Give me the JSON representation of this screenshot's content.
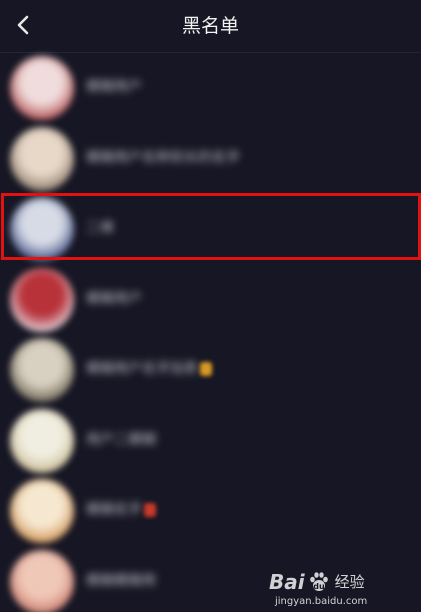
{
  "header": {
    "title": "黑名单",
    "back_icon": "chevron-left-icon"
  },
  "blacklist": [
    {
      "name": "模糊用户",
      "avatar_colors": [
        "#f0dcdc",
        "#b04a4a"
      ],
      "badge": null
    },
    {
      "name": "模糊用户名称较长的名字",
      "avatar_colors": [
        "#e8d8c8",
        "#8a7a6a"
      ],
      "badge": null
    },
    {
      "name": "二维",
      "avatar_colors": [
        "#d7dbe6",
        "#3a4a80"
      ],
      "badge": null
    },
    {
      "name": "模糊用户",
      "avatar_colors": [
        "#b8323a",
        "#e8e8ee"
      ],
      "badge": null
    },
    {
      "name": "模糊用户名字加表",
      "avatar_colors": [
        "#d8d0c0",
        "#6a6250"
      ],
      "badge": "#d99a25"
    },
    {
      "name": "用户二模糊",
      "avatar_colors": [
        "#f0eee0",
        "#c8b890"
      ],
      "badge": null
    },
    {
      "name": "模糊名字",
      "avatar_colors": [
        "#f6e8d0",
        "#d09050"
      ],
      "badge": "#c83a2a"
    },
    {
      "name": "模糊模糊用",
      "avatar_colors": [
        "#f0c8b8",
        "#c8786a"
      ],
      "badge": null
    }
  ],
  "highlight_color": "#e31212",
  "watermark": {
    "brand": "Bai",
    "paw_icon": "baidu-paw-icon",
    "product": "经验",
    "url": "jingyan.baidu.com"
  }
}
